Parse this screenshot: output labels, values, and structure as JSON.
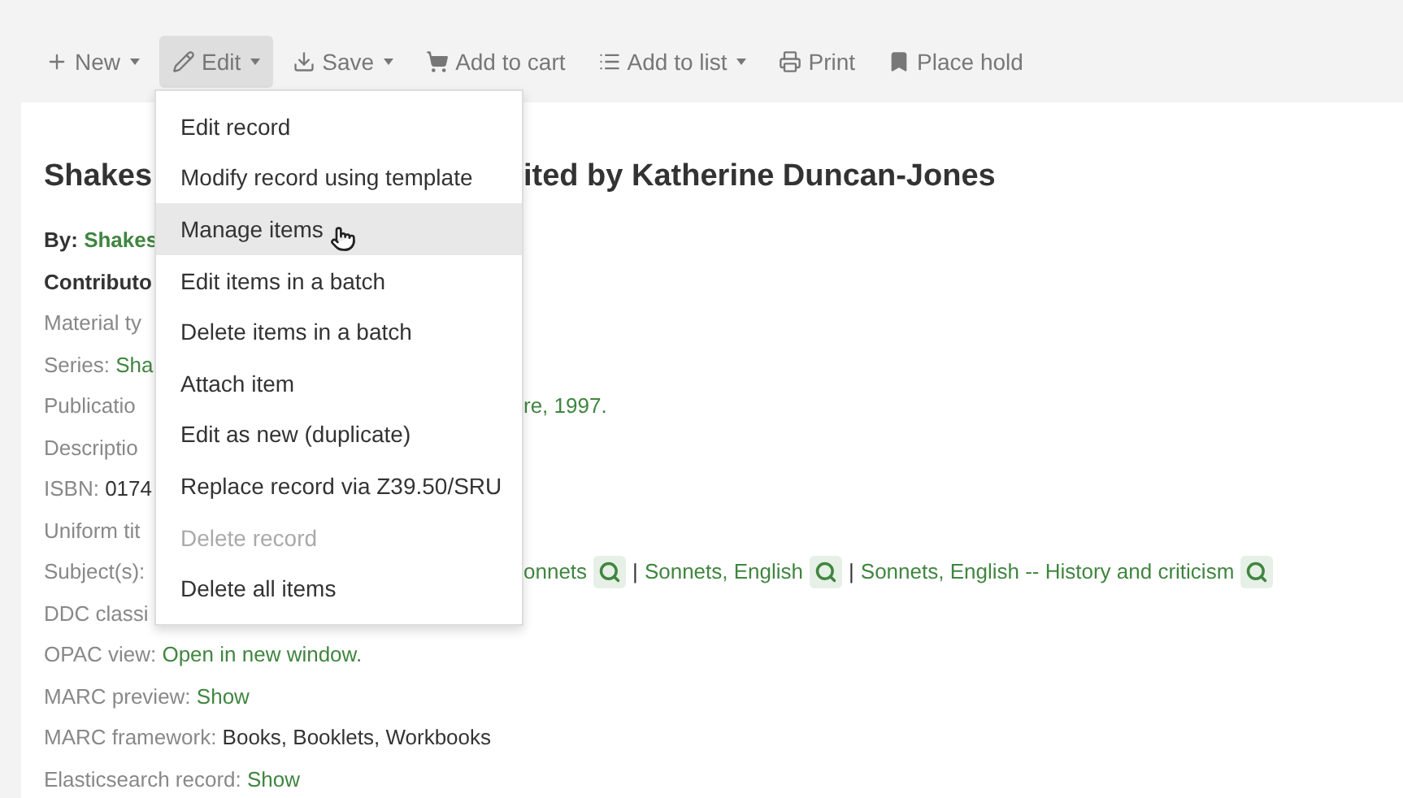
{
  "toolbar": [
    {
      "label": "New",
      "kind": "plus",
      "caret": true,
      "selected": false
    },
    {
      "label": "Edit",
      "kind": "pencil",
      "caret": true,
      "selected": true
    },
    {
      "label": "Save",
      "kind": "download",
      "caret": true,
      "selected": false
    },
    {
      "label": "Add to cart",
      "kind": "cart",
      "caret": false,
      "selected": false
    },
    {
      "label": "Add to list",
      "kind": "list",
      "caret": true,
      "selected": false
    },
    {
      "label": "Print",
      "kind": "printer",
      "caret": false,
      "selected": false
    },
    {
      "label": "Place hold",
      "kind": "bookmark",
      "caret": false,
      "selected": false
    }
  ],
  "edit_menu": [
    {
      "label": "Edit record",
      "selected": false,
      "disabled": false
    },
    {
      "label": "Modify record using template",
      "selected": false,
      "disabled": false
    },
    {
      "label": "Manage items",
      "selected": true,
      "disabled": false
    },
    {
      "label": "Edit items in a batch",
      "selected": false,
      "disabled": false
    },
    {
      "label": "Delete items in a batch",
      "selected": false,
      "disabled": false
    },
    {
      "label": "Attach item",
      "selected": false,
      "disabled": false
    },
    {
      "label": "Edit as new (duplicate)",
      "selected": false,
      "disabled": false
    },
    {
      "label": "Replace record via Z39.50/SRU",
      "selected": false,
      "disabled": false
    },
    {
      "label": "Delete record",
      "selected": false,
      "disabled": true
    },
    {
      "label": "Delete all items",
      "selected": false,
      "disabled": false
    }
  ],
  "title": {
    "left": "Shakes",
    "right": "ited by Katherine Duncan-Jones"
  },
  "rows": [
    {
      "left": [
        {
          "kind": "strong",
          "text": "By: "
        },
        {
          "kind": "stronglink",
          "text": "Shakes"
        }
      ],
      "right": []
    },
    {
      "left": [
        {
          "kind": "strong",
          "text": "Contributo"
        }
      ],
      "right": []
    },
    {
      "left": [
        {
          "kind": "label",
          "text": "Material ty"
        }
      ],
      "right": []
    },
    {
      "left": [
        {
          "kind": "label",
          "text": "Series: "
        },
        {
          "kind": "link",
          "text": "Sha"
        }
      ],
      "right": []
    },
    {
      "left": [
        {
          "kind": "label",
          "text": "Publicatio"
        }
      ],
      "right": [
        {
          "kind": "link",
          "text": "re, 1997."
        }
      ]
    },
    {
      "left": [
        {
          "kind": "label",
          "text": "Descriptio"
        }
      ],
      "right": []
    },
    {
      "left": [
        {
          "kind": "label",
          "text": "ISBN: "
        },
        {
          "kind": "value",
          "text": "0174"
        }
      ],
      "right": []
    },
    {
      "left": [
        {
          "kind": "label",
          "text": "Uniform tit"
        }
      ],
      "right": []
    },
    {
      "left": [
        {
          "kind": "label",
          "text": "Subject(s):"
        }
      ],
      "right": [
        {
          "kind": "link",
          "text": "onnets"
        },
        {
          "kind": "search"
        },
        {
          "kind": "value",
          "text": "|"
        },
        {
          "kind": "link",
          "text": "Sonnets, English"
        },
        {
          "kind": "search"
        },
        {
          "kind": "value",
          "text": "|"
        },
        {
          "kind": "link",
          "text": "Sonnets, English -- History and criticism"
        },
        {
          "kind": "search"
        }
      ]
    },
    {
      "left": [
        {
          "kind": "label",
          "text": "DDC classi"
        }
      ],
      "right": []
    }
  ],
  "full_rows": [
    [
      {
        "kind": "label",
        "text": "OPAC view: "
      },
      {
        "kind": "link",
        "text": "Open in new window."
      }
    ],
    [
      {
        "kind": "label",
        "text": "MARC preview: "
      },
      {
        "kind": "link",
        "text": "Show"
      }
    ],
    [
      {
        "kind": "label",
        "text": "MARC framework: "
      },
      {
        "kind": "value",
        "text": "Books, Booklets, Workbooks"
      }
    ],
    [
      {
        "kind": "label",
        "text": "Elasticsearch record: "
      },
      {
        "kind": "link",
        "text": "Show"
      }
    ]
  ]
}
